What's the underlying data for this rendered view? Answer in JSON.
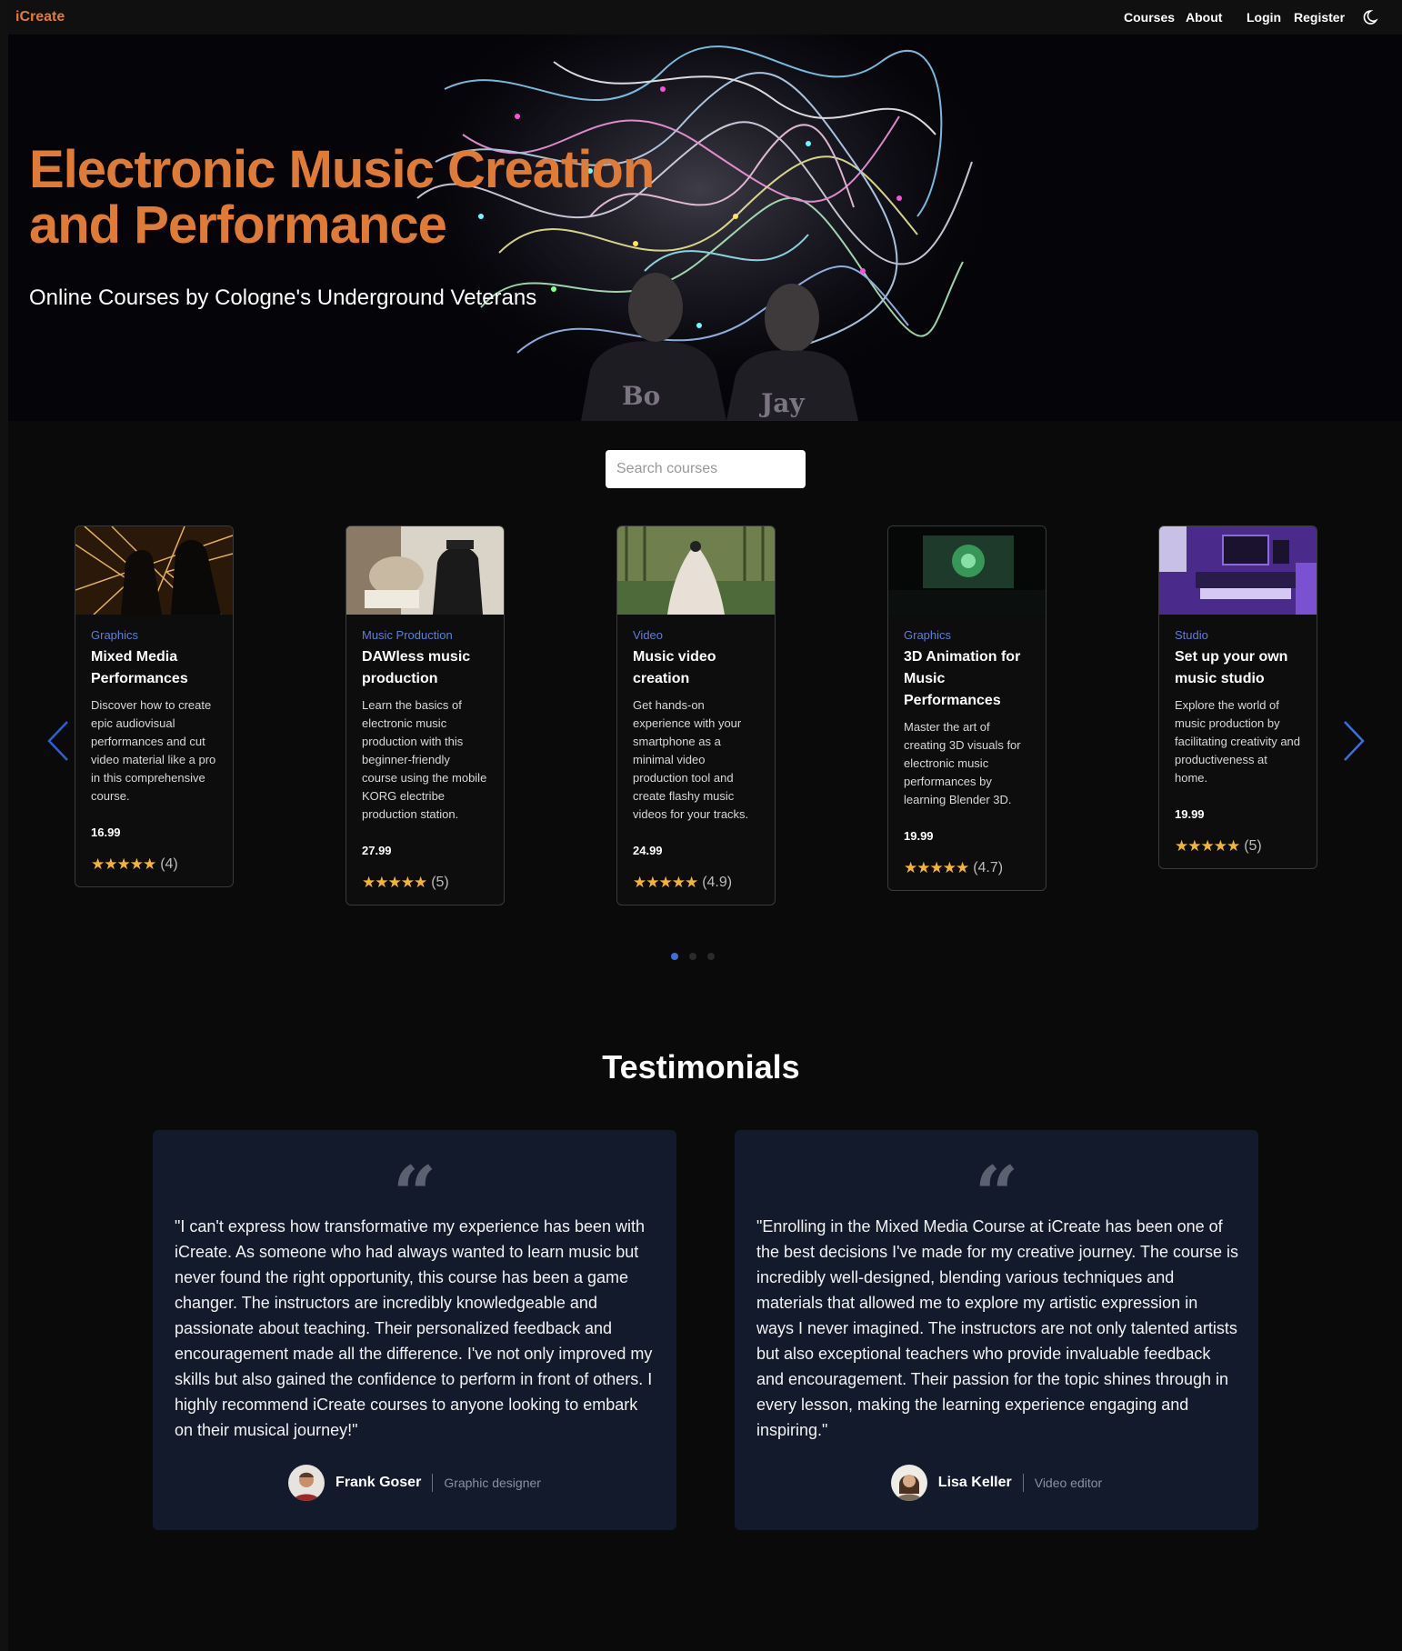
{
  "nav": {
    "brand": "iCreate",
    "courses": "Courses",
    "about": "About",
    "login": "Login",
    "register": "Register",
    "theme_icon": "moon-icon"
  },
  "hero": {
    "title": "Electronic Music Creation and Performance",
    "subtitle": "Online Courses by Cologne's Underground Veterans",
    "shirt_left": "Bo",
    "shirt_right": "Jay"
  },
  "search": {
    "placeholder": "Search courses"
  },
  "courses": [
    {
      "category": "Graphics",
      "title": "Mixed Media Performances",
      "description": "Discover how to create epic audiovisual performances and cut video material like a pro in this comprehensive course.",
      "price": "16.99",
      "rating": "(4)"
    },
    {
      "category": "Music Production",
      "title": "DAWless music production",
      "description": "Learn the basics of electronic music production with this beginner-friendly course using the mobile KORG electribe production station.",
      "price": "27.99",
      "rating": "(5)"
    },
    {
      "category": "Video",
      "title": "Music video creation",
      "description": "Get hands-on experience with your smartphone as a minimal video production tool and create flashy music videos for your tracks.",
      "price": "24.99",
      "rating": "(4.9)"
    },
    {
      "category": "Graphics",
      "title": "3D Animation for Music Performances",
      "description": "Master the art of creating 3D visuals for electronic music performances by learning Blender 3D.",
      "price": "19.99",
      "rating": "(4.7)"
    },
    {
      "category": "Studio",
      "title": "Set up your own music studio",
      "description": "Explore the world of music production by facilitating creativity and productiveness at home.",
      "price": "19.99",
      "rating": "(5)"
    }
  ],
  "stars": "★★★★★",
  "colors": {
    "accent": "#e07b35",
    "link": "#5b7fd9",
    "star": "#f2b533",
    "card_bg": "#131a2c"
  },
  "testimonials": {
    "heading": "Testimonials",
    "items": [
      {
        "quote": "\"I can't express how transformative my experience has been with iCreate. As someone who had always wanted to learn music but never found the right opportunity, this course has been a game changer. The instructors are incredibly knowledgeable and passionate about teaching. Their personalized feedback and encouragement made all the difference. I've not only improved my skills but also gained the confidence to perform in front of others. I highly recommend iCreate courses to anyone looking to embark on their musical journey!\"",
        "name": "Frank Goser",
        "role": "Graphic designer"
      },
      {
        "quote": "\"Enrolling in the Mixed Media Course at iCreate has been one of the best decisions I've made for my creative journey. The course is incredibly well-designed, blending various techniques and materials that allowed me to explore my artistic expression in ways I never imagined. The instructors are not only talented artists but also exceptional teachers who provide invaluable feedback and encouragement. Their passion for the topic shines through in every lesson, making the learning experience engaging and inspiring.\"",
        "name": "Lisa Keller",
        "role": "Video editor"
      }
    ]
  }
}
